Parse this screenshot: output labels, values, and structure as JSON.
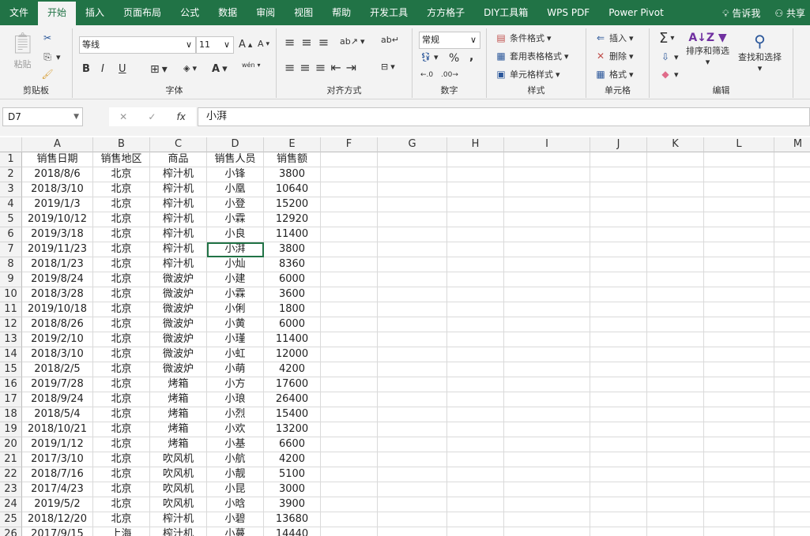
{
  "tabs": [
    "文件",
    "开始",
    "插入",
    "页面布局",
    "公式",
    "数据",
    "审阅",
    "视图",
    "帮助",
    "开发工具",
    "方方格子",
    "DIY工具箱",
    "WPS PDF",
    "Power Pivot"
  ],
  "active_tab": 1,
  "tell_me": "告诉我",
  "share": "共享",
  "ribbon": {
    "clipboard": {
      "paste": "粘贴",
      "label": "剪贴板"
    },
    "font": {
      "name": "等线",
      "size": "11",
      "bold": "B",
      "italic": "I",
      "underline": "U",
      "font_color": "A",
      "phonetic": "wén",
      "label": "字体"
    },
    "alignment": {
      "label": "对齐方式"
    },
    "number": {
      "format": "常规",
      "percent": "%",
      "comma": ",",
      "label": "数字"
    },
    "styles": {
      "conditional": "条件格式",
      "table": "套用表格格式",
      "cell_styles": "单元格样式",
      "label": "样式"
    },
    "cells": {
      "insert": "插入",
      "delete": "删除",
      "format": "格式",
      "label": "单元格"
    },
    "editing": {
      "sort": "排序和筛选",
      "find": "查找和选择",
      "label": "编辑"
    }
  },
  "formula_bar": {
    "name_box": "D7",
    "value": "小湃"
  },
  "columns": [
    "A",
    "B",
    "C",
    "D",
    "E",
    "F",
    "G",
    "H",
    "I",
    "J",
    "K",
    "L",
    "M"
  ],
  "rows": [
    [
      "销售日期",
      "销售地区",
      "商品",
      "销售人员",
      "销售额"
    ],
    [
      "2018/8/6",
      "北京",
      "榨汁机",
      "小锋",
      "3800"
    ],
    [
      "2018/3/10",
      "北京",
      "榨汁机",
      "小凰",
      "10640"
    ],
    [
      "2019/1/3",
      "北京",
      "榨汁机",
      "小登",
      "15200"
    ],
    [
      "2019/10/12",
      "北京",
      "榨汁机",
      "小霖",
      "12920"
    ],
    [
      "2019/3/18",
      "北京",
      "榨汁机",
      "小良",
      "11400"
    ],
    [
      "2019/11/23",
      "北京",
      "榨汁机",
      "小湃",
      "3800"
    ],
    [
      "2018/1/23",
      "北京",
      "榨汁机",
      "小灿",
      "8360"
    ],
    [
      "2019/8/24",
      "北京",
      "微波炉",
      "小建",
      "6000"
    ],
    [
      "2018/3/28",
      "北京",
      "微波炉",
      "小霖",
      "3600"
    ],
    [
      "2019/10/18",
      "北京",
      "微波炉",
      "小俐",
      "1800"
    ],
    [
      "2018/8/26",
      "北京",
      "微波炉",
      "小黄",
      "6000"
    ],
    [
      "2019/2/10",
      "北京",
      "微波炉",
      "小瑾",
      "11400"
    ],
    [
      "2018/3/10",
      "北京",
      "微波炉",
      "小虹",
      "12000"
    ],
    [
      "2018/2/5",
      "北京",
      "微波炉",
      "小萌",
      "4200"
    ],
    [
      "2019/7/28",
      "北京",
      "烤箱",
      "小方",
      "17600"
    ],
    [
      "2018/9/24",
      "北京",
      "烤箱",
      "小琅",
      "26400"
    ],
    [
      "2018/5/4",
      "北京",
      "烤箱",
      "小烈",
      "15400"
    ],
    [
      "2018/10/21",
      "北京",
      "烤箱",
      "小欢",
      "13200"
    ],
    [
      "2019/1/12",
      "北京",
      "烤箱",
      "小基",
      "6600"
    ],
    [
      "2017/3/10",
      "北京",
      "吹风机",
      "小航",
      "4200"
    ],
    [
      "2018/7/16",
      "北京",
      "吹风机",
      "小靓",
      "5100"
    ],
    [
      "2017/4/23",
      "北京",
      "吹风机",
      "小昆",
      "3000"
    ],
    [
      "2019/5/2",
      "北京",
      "吹风机",
      "小晗",
      "3900"
    ],
    [
      "2018/12/20",
      "北京",
      "榨汁机",
      "小碧",
      "13680"
    ],
    [
      "2017/9/15",
      "上海",
      "榨汁机",
      "小蔓",
      "14440"
    ]
  ]
}
